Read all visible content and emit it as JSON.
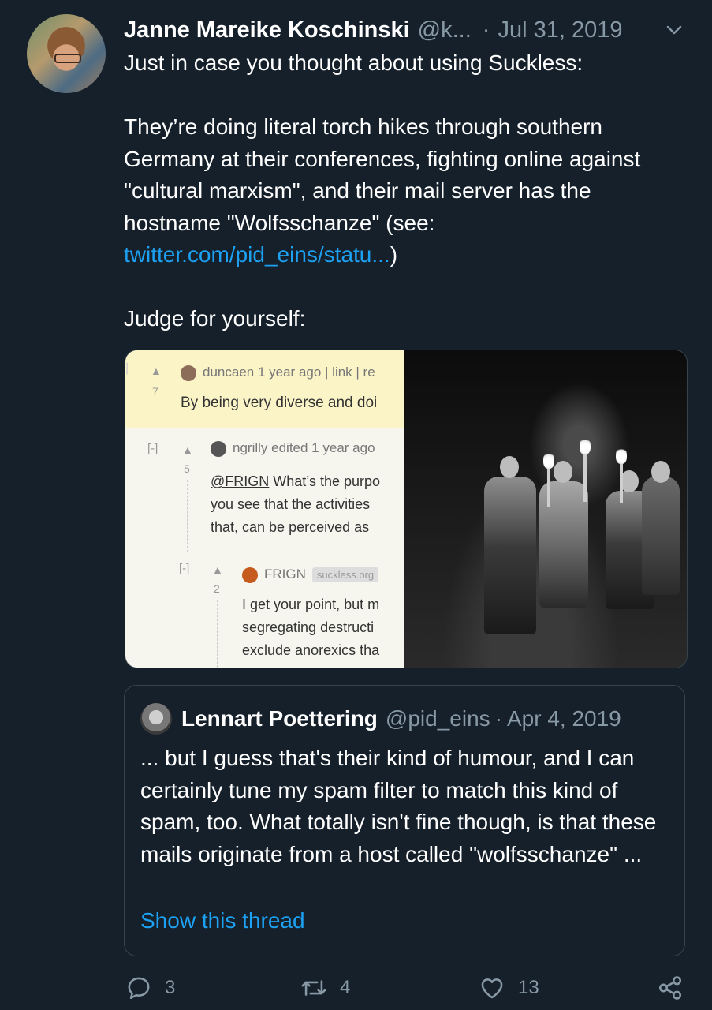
{
  "tweet": {
    "author_name": "Janne Mareike Koschinski",
    "author_handle": "@k...",
    "separator": "·",
    "date": "Jul 31, 2019",
    "text_line1": "Just in case you thought about using Suckless:",
    "paragraph2_before_link": "They’re doing literal torch hikes through southern Germany at their conferences, fighting online against \"cultural marxism\", and their mail server has the hostname \"Wolfsschanze\" (see:",
    "link_text": "twitter.com/pid_eins/statu...",
    "paragraph2_after_link": ")",
    "text_line3": "Judge for yourself:"
  },
  "media_screenshot": {
    "c1_user": "duncaen",
    "c1_meta": "1 year ago | link | re",
    "c1_votes": "7",
    "c1_text": "By being very diverse and doi",
    "c2_toggle": "[-]",
    "c2_user": "ngrilly",
    "c2_meta": "edited 1 year ago",
    "c2_votes": "5",
    "c2_mention": "@FRIGN",
    "c2_line1_rest": " What’s the purpo",
    "c2_line2": "you see that the activities",
    "c2_line3": "that, can be perceived as",
    "c3_toggle": "[-]",
    "c3_user": "FRIGN",
    "c3_tag": "suckless.org",
    "c3_votes": "2",
    "c3_line1": "I get your point, but m",
    "c3_line2": "segregating destructi",
    "c3_line3": "exclude anorexics tha"
  },
  "quote": {
    "author_name": "Lennart Poettering",
    "author_handle": "@pid_eins",
    "separator": "·",
    "date": "Apr 4, 2019",
    "text": "... but I guess that's their kind of humour, and I can certainly tune my spam filter to match this kind of spam, too. What totally isn't fine though, is that these mails originate from a host called \"wolfsschanze\" ...",
    "show_thread": "Show this thread"
  },
  "actions": {
    "reply_count": "3",
    "retweet_count": "4",
    "like_count": "13"
  },
  "icons": {
    "caret": "chevron-down-icon",
    "reply": "reply-icon",
    "retweet": "retweet-icon",
    "like": "heart-icon",
    "share": "share-icon"
  },
  "colors": {
    "background": "#15202b",
    "link": "#1da1f2",
    "secondary_text": "#8899a6",
    "border": "#38444d"
  }
}
